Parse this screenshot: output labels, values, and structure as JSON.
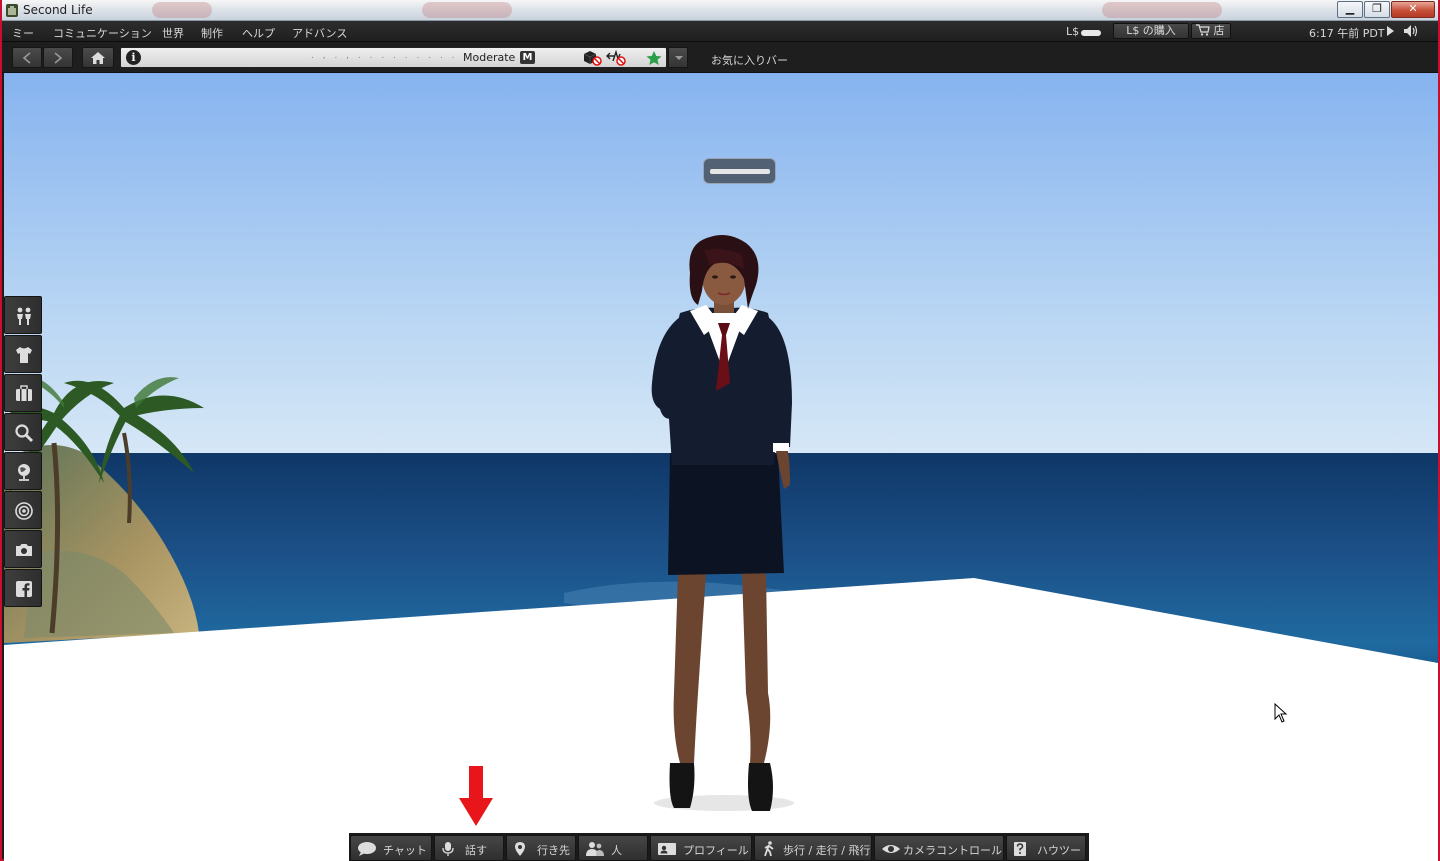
{
  "window": {
    "title": "Second Life"
  },
  "menu": {
    "items": [
      "ミー",
      "コミュニケーション",
      "世界",
      "制作",
      "ヘルプ",
      "アドバンス"
    ]
  },
  "status": {
    "currency_label": "L$",
    "buy_currency_label": "L$ の購入",
    "shop_label": "店",
    "time": "6:17 午前 PDT"
  },
  "navigation": {
    "location_text": ". , . , . . . . . . . . . . . .",
    "maturity_rating": "Moderate",
    "maturity_badge": "M",
    "favorites_bar": "お気に入りバー"
  },
  "bottom_toolbar": {
    "buttons": [
      {
        "label": "チャット",
        "icon": "chat-bubble-icon"
      },
      {
        "label": "話す",
        "icon": "microphone-icon"
      },
      {
        "label": "行き先",
        "icon": "map-pin-icon"
      },
      {
        "label": "人",
        "icon": "people-icon"
      },
      {
        "label": "プロフィール",
        "icon": "profile-card-icon"
      },
      {
        "label": "歩行 / 走行 / 飛行",
        "icon": "walking-person-icon"
      },
      {
        "label": "カメラコントロール",
        "icon": "eye-icon"
      },
      {
        "label": "ハウツー",
        "icon": "help-book-icon"
      }
    ]
  },
  "left_toolbar": {
    "icons": [
      "avatar-people-icon",
      "appearance-shirt-icon",
      "inventory-suitcase-icon",
      "search-icon",
      "map-globe-icon",
      "radar-icon",
      "snapshot-camera-icon",
      "facebook-icon"
    ]
  },
  "colors": {
    "window_border": "#c8102e",
    "annotation_arrow": "#e8161b",
    "sky_top": "#86b3ef",
    "ocean": "#1b4f86",
    "ground": "#ffffff"
  }
}
